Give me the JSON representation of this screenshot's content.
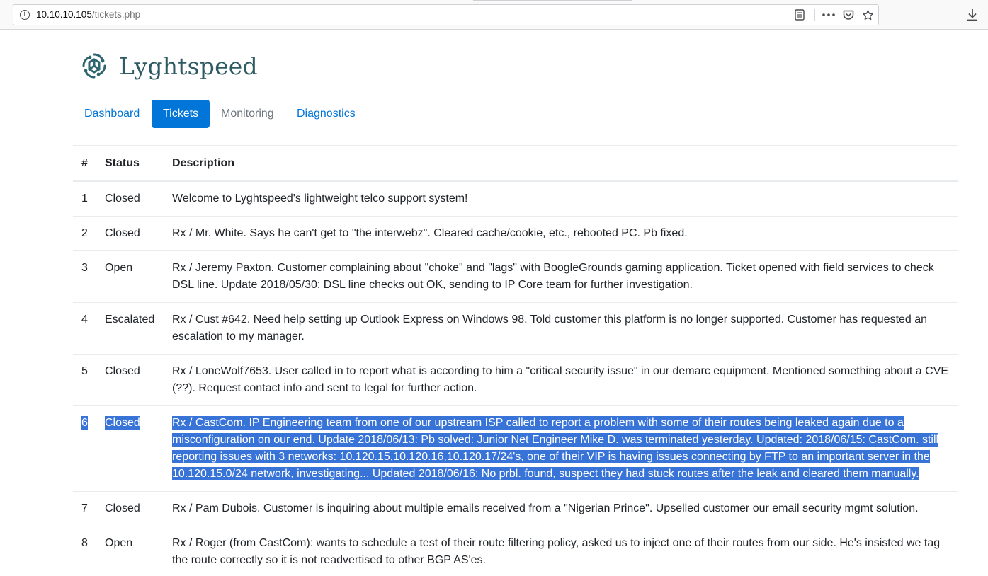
{
  "browser": {
    "url_host": "10.10.10.105",
    "url_path": "/tickets.php"
  },
  "brand": {
    "name": "Lyghtspeed"
  },
  "nav": [
    {
      "label": "Dashboard",
      "active": false
    },
    {
      "label": "Tickets",
      "active": true
    },
    {
      "label": "Monitoring",
      "active": false
    },
    {
      "label": "Diagnostics",
      "active": false
    }
  ],
  "table": {
    "headers": [
      "#",
      "Status",
      "Description"
    ],
    "rows": [
      {
        "num": "1",
        "status": "Closed",
        "description": "Welcome to Lyghtspeed's lightweight telco support system!",
        "selected": false
      },
      {
        "num": "2",
        "status": "Closed",
        "description": "Rx / Mr. White. Says he can't get to \"the interwebz\". Cleared cache/cookie, etc., rebooted PC. Pb fixed.",
        "selected": false
      },
      {
        "num": "3",
        "status": "Open",
        "description": "Rx / Jeremy Paxton. Customer complaining about \"choke\" and \"lags\" with BoogleGrounds gaming application. Ticket opened with field services to check DSL line. Update 2018/05/30: DSL line checks out OK, sending to IP Core team for further investigation.",
        "selected": false
      },
      {
        "num": "4",
        "status": "Escalated",
        "description": "Rx / Cust #642. Need help setting up Outlook Express on Windows 98. Told customer this platform is no longer supported. Customer has requested an escalation to my manager.",
        "selected": false
      },
      {
        "num": "5",
        "status": "Closed",
        "description": "Rx / LoneWolf7653. User called in to report what is according to him a \"critical security issue\" in our demarc equipment. Mentioned something about a CVE (??). Request contact info and sent to legal for further action.",
        "selected": false
      },
      {
        "num": "6",
        "status": "Closed",
        "description": "Rx / CastCom. IP Engineering team from one of our upstream ISP called to report a problem with some of their routes being leaked again due to a misconfiguration on our end. Update 2018/06/13: Pb solved: Junior Net Engineer Mike D. was terminated yesterday. Updated: 2018/06/15: CastCom. still reporting issues with 3 networks: 10.120.15,10.120.16,10.120.17/24's, one of their VIP is having issues connecting by FTP to an important server in the 10.120.15.0/24 network, investigating... Updated 2018/06/16: No prbl. found, suspect they had stuck routes after the leak and cleared them manually.",
        "selected": true
      },
      {
        "num": "7",
        "status": "Closed",
        "description": "Rx / Pam Dubois. Customer is inquiring about multiple emails received from a \"Nigerian Prince\". Upselled customer our email security mgmt solution.",
        "selected": false
      },
      {
        "num": "8",
        "status": "Open",
        "description": "Rx / Roger (from CastCom): wants to schedule a test of their route filtering policy, asked us to inject one of their routes from our side. He's insisted we tag the route correctly so it is not readvertised to other BGP AS'es.",
        "selected": false
      }
    ]
  },
  "colors": {
    "link": "#0275d8",
    "brand_text": "#2e5a63",
    "selection": "#3874d8"
  }
}
